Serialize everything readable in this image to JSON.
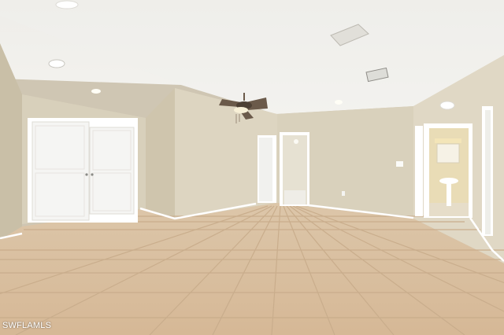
{
  "watermark": {
    "text": "SWFLAMLS"
  },
  "scene": {
    "subject": "empty-room-interior",
    "colors": {
      "ceiling": "#f1f0ec",
      "wall": "#dcd4c0",
      "wall_shadow": "#cbc1aa",
      "floor_tile": "#d9c0a0",
      "grout": "#c7ab8a",
      "door": "#f6f6f4",
      "trim": "#ffffff",
      "fan_blade": "#6b5a4a"
    }
  }
}
